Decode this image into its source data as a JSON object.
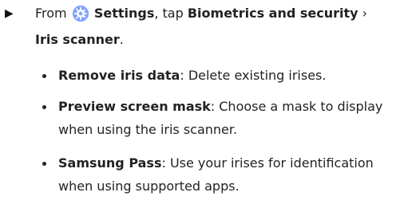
{
  "step": {
    "arrow": "▶",
    "from": "From",
    "settings": "Settings",
    "tap": ", tap",
    "biometrics": "Biometrics and security",
    "chevron": "›",
    "iris_scanner": "Iris scanner",
    "period": "."
  },
  "bullets": [
    {
      "title": "Remove iris data",
      "text": ": Delete existing irises."
    },
    {
      "title": "Preview screen mask",
      "text": ": Choose a mask to display when using the iris scanner."
    },
    {
      "title": "Samsung Pass",
      "text": ": Use your irises for identification when using supported apps."
    }
  ],
  "colors": {
    "settings_icon": "#7ea4ff",
    "text": "#222222"
  },
  "icons": {
    "settings": "gear-icon",
    "step": "play-arrow-icon"
  }
}
